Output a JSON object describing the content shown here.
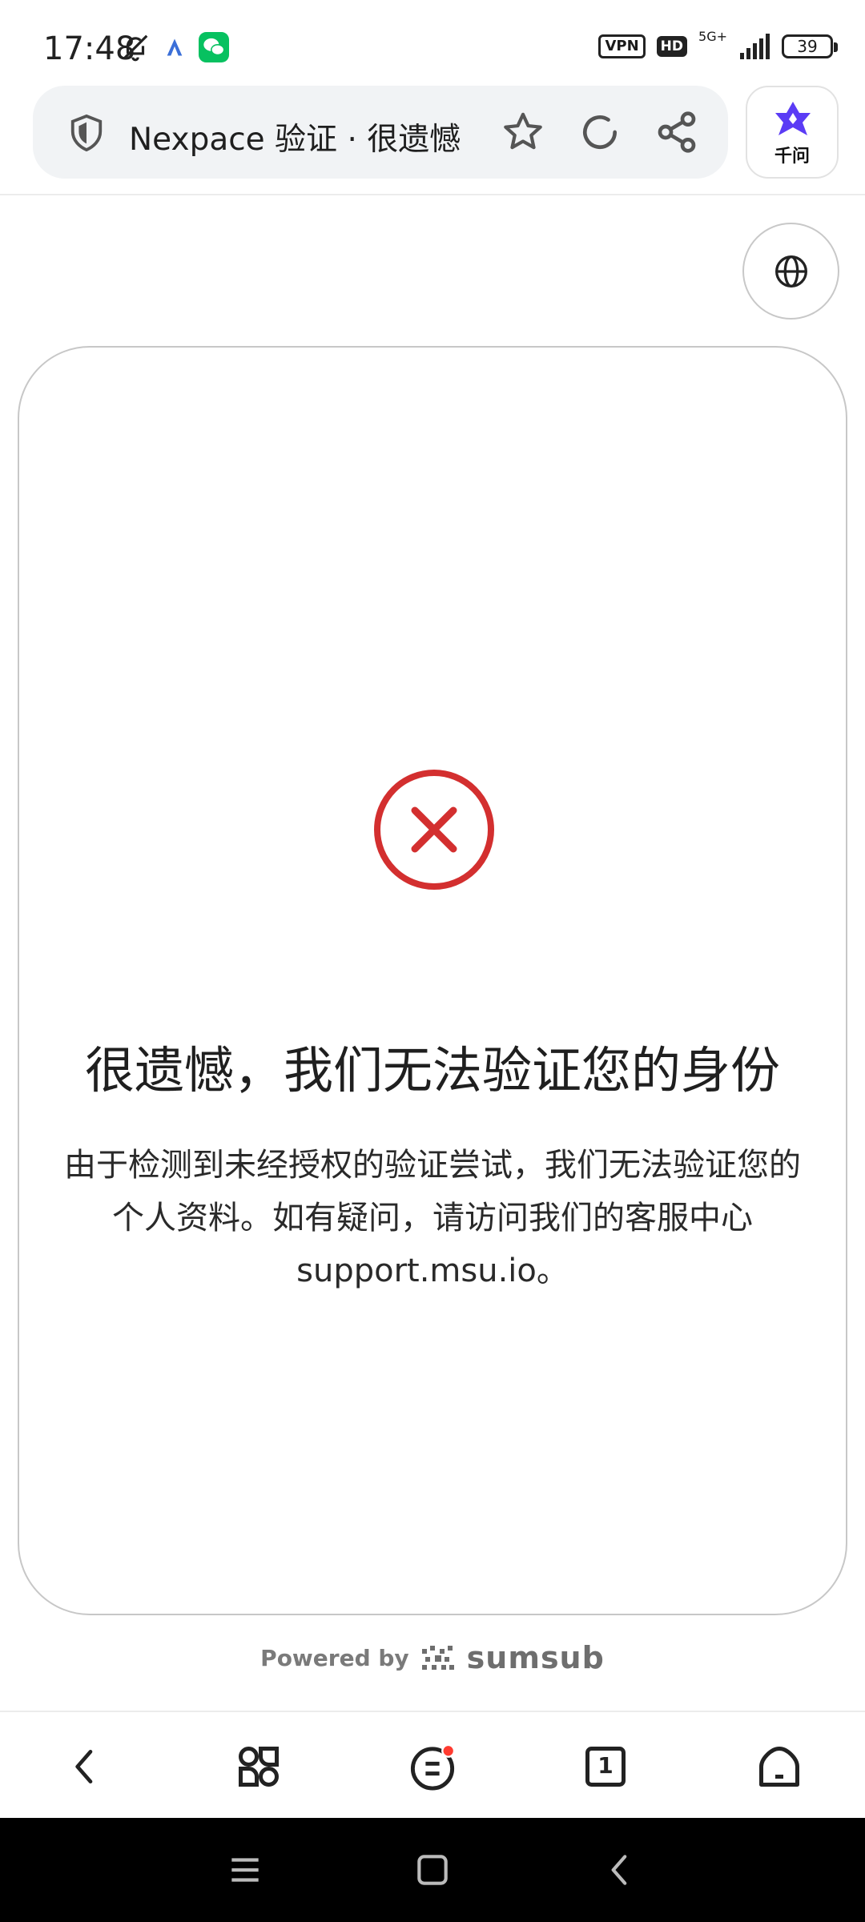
{
  "status_bar": {
    "time": "17:48",
    "vpn": "VPN",
    "hd": "HD",
    "network": "5G+",
    "battery": "39",
    "icons": [
      "bell-off-icon",
      "translate-icon",
      "wechat-icon",
      "signal-icon"
    ]
  },
  "url_bar": {
    "title": "Nexpace 验证 · 很遗憾",
    "icons": [
      "shield-icon",
      "star-icon",
      "reload-icon",
      "share-icon"
    ]
  },
  "assistant": {
    "label": "千问"
  },
  "card": {
    "title": "很遗憾，我们无法验证您的身份",
    "message": "由于检测到未经授权的验证尝试，我们无法验证您的个人资料。如有疑问，请访问我们的客服中心 support.msu.io。"
  },
  "footer": {
    "powered_by": "Powered by",
    "brand": "sumsub"
  },
  "browser_nav": {
    "tab_count": "1",
    "icons": [
      "back-icon",
      "shortcuts-icon",
      "menu-icon",
      "tabs-icon",
      "home-icon"
    ]
  },
  "colors": {
    "error_red": "#d32f2f",
    "assistant_purple": "#5b3cf5",
    "wechat_green": "#07c160",
    "notification_dot": "#ff3b30"
  }
}
